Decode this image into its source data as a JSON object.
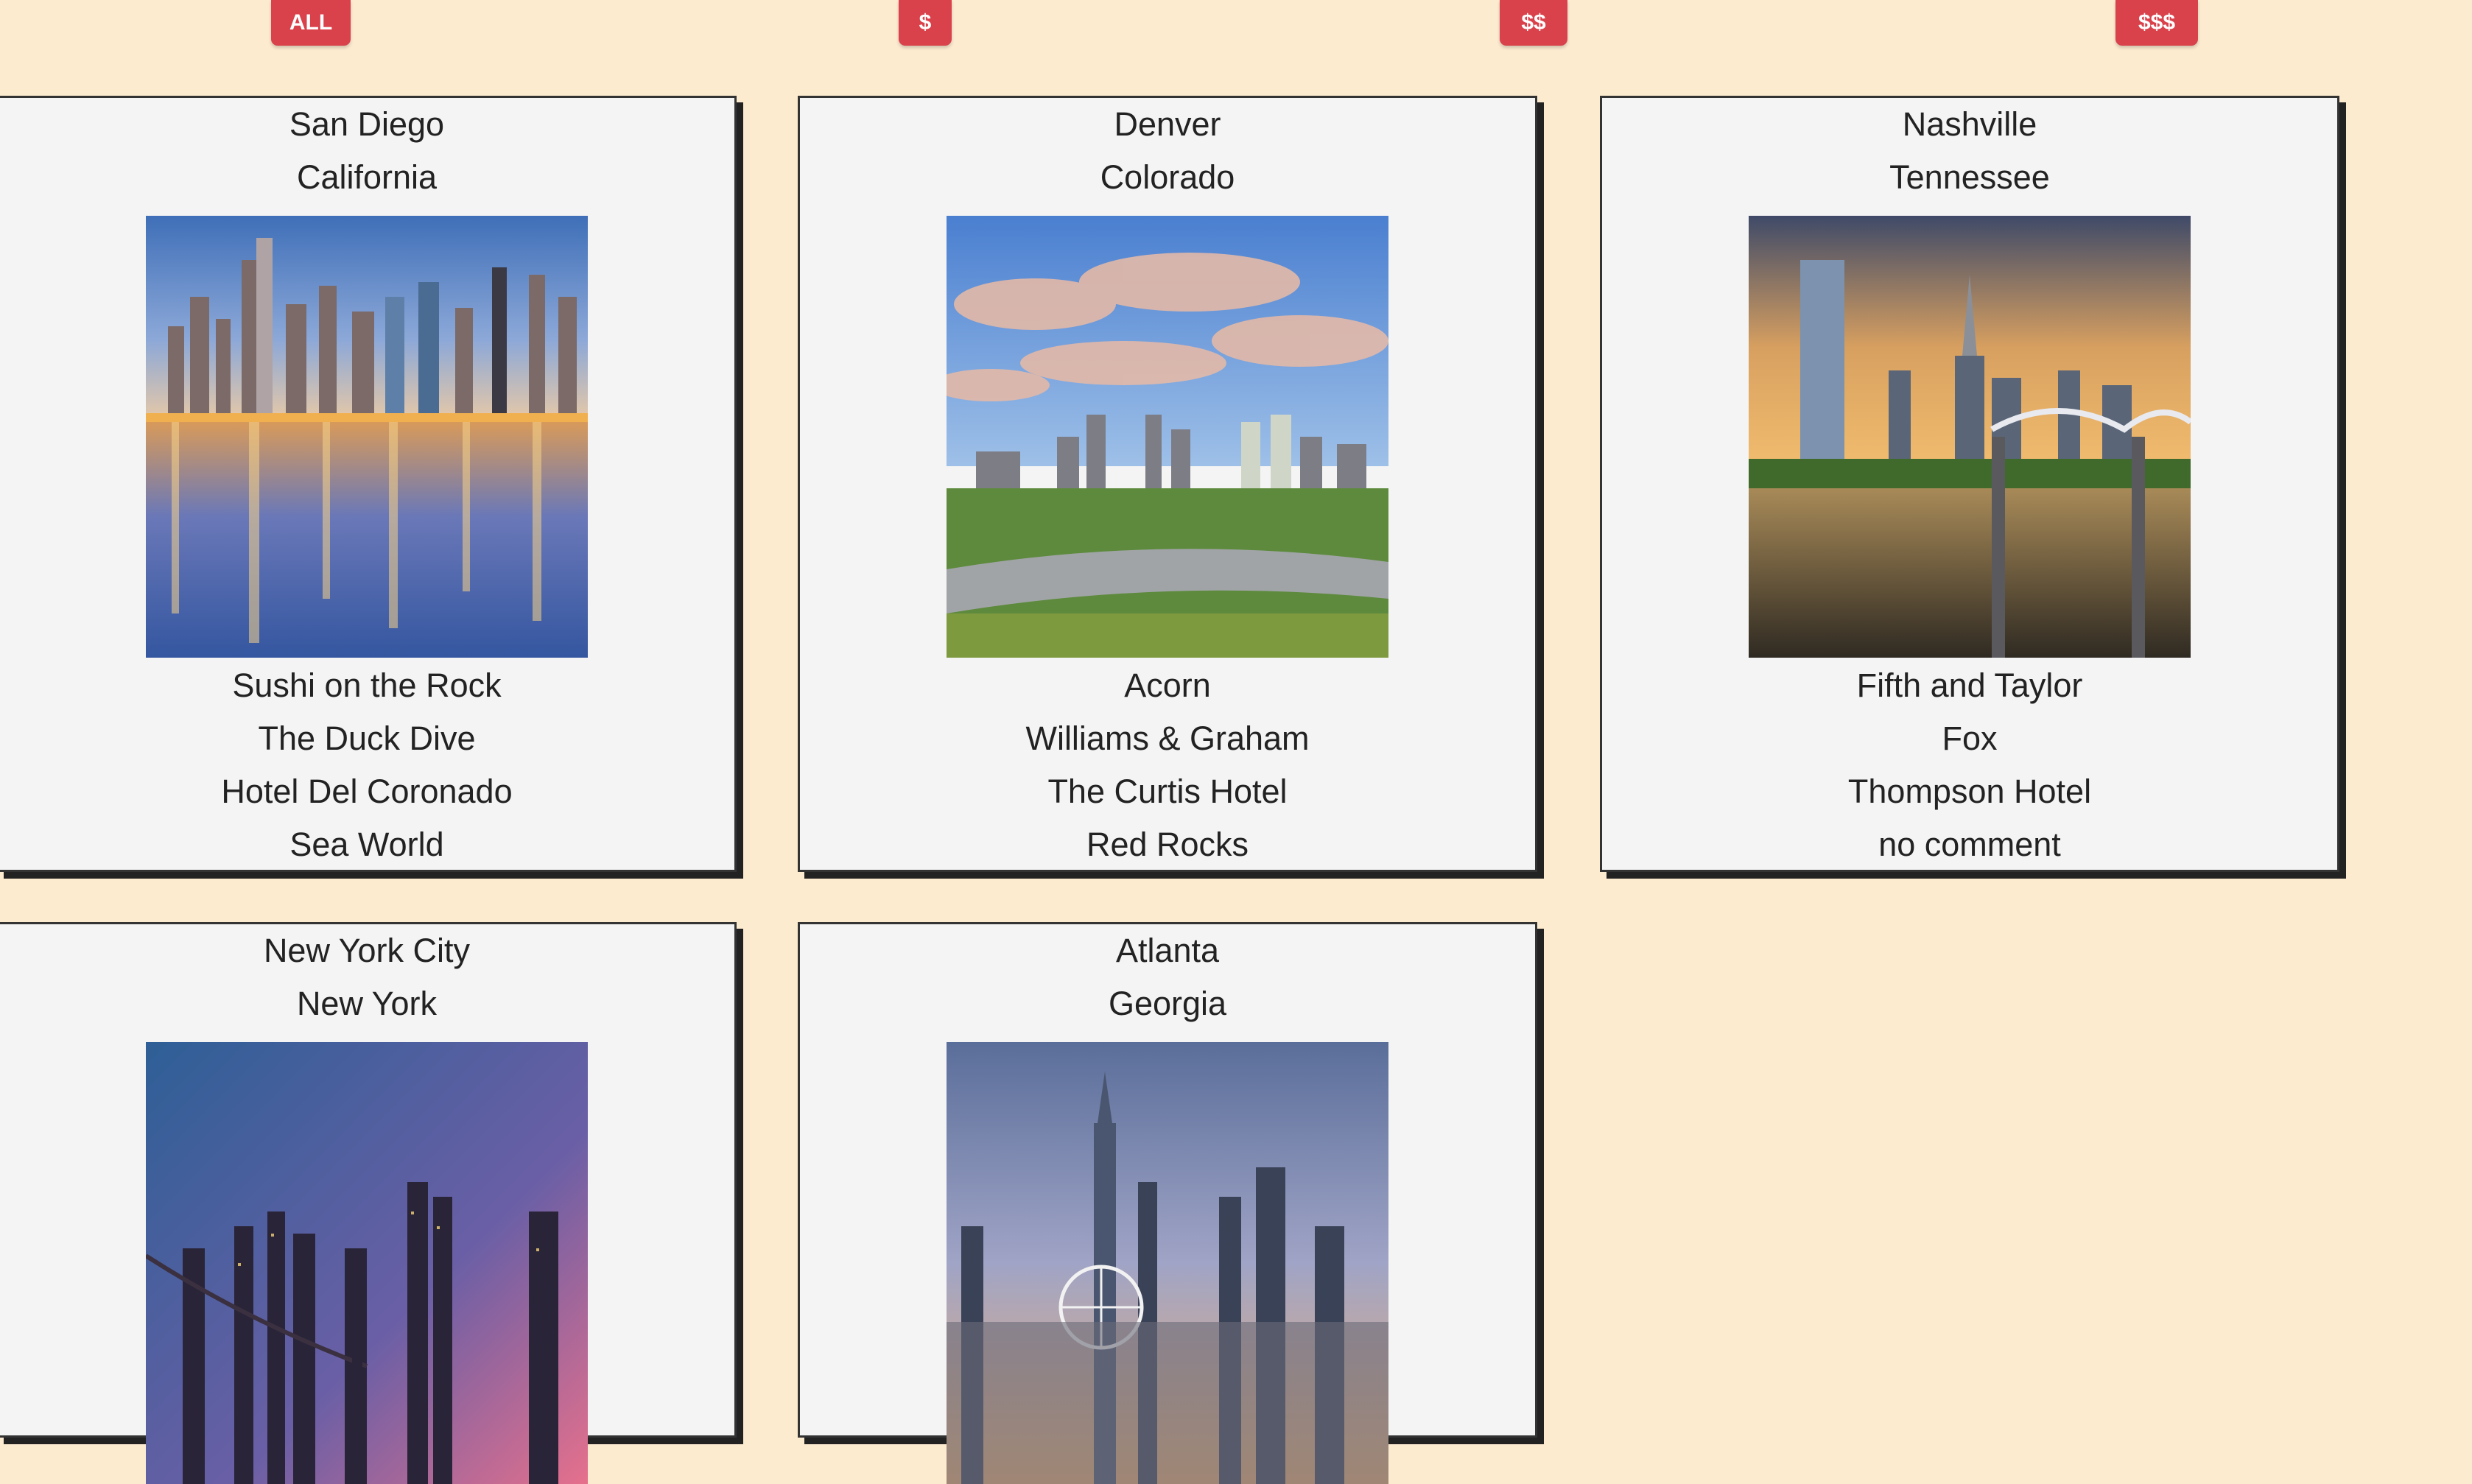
{
  "filters": [
    {
      "label": "ALL"
    },
    {
      "label": "$"
    },
    {
      "label": "$$"
    },
    {
      "label": "$$$"
    }
  ],
  "cards": [
    {
      "city": "San Diego",
      "state": "California",
      "items": [
        "Sushi on the Rock",
        "The Duck Dive",
        "Hotel Del Coronado",
        "Sea World"
      ]
    },
    {
      "city": "Denver",
      "state": "Colorado",
      "items": [
        "Acorn",
        "Williams & Graham",
        "The Curtis Hotel",
        "Red Rocks"
      ]
    },
    {
      "city": "Nashville",
      "state": "Tennessee",
      "items": [
        "Fifth and Taylor",
        "Fox",
        "Thompson Hotel",
        "no comment"
      ]
    },
    {
      "city": "New York City",
      "state": "New York",
      "items": []
    },
    {
      "city": "Atlanta",
      "state": "Georgia",
      "items": []
    }
  ],
  "colors": {
    "page_background": "#fdebd0",
    "filter_button": "#d9414b",
    "card_background": "#f4f4f4",
    "card_shadow": "#222222"
  }
}
